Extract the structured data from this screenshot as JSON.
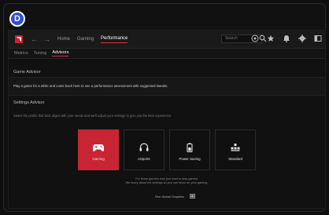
{
  "badge": "D",
  "topbar": {
    "nav": [
      "Home",
      "Gaming",
      "Performance"
    ],
    "active_nav": "Performance",
    "search_placeholder": "Search"
  },
  "subtabs": [
    "Metrics",
    "Tuning",
    "Advisors"
  ],
  "game_advisor": {
    "title": "Game Advisor",
    "message": "Play a game for a while and come back here to see a performance assessment with suggested tweaks."
  },
  "settings_advisor": {
    "title": "Settings Advisor",
    "description": "Select the profile that best aligns with your needs and we'll adjust your settings to give you the best experience.",
    "profiles": [
      {
        "label": "Gaming",
        "icon": "gamepad-icon",
        "selected": true
      },
      {
        "label": "eSports",
        "icon": "headset-icon",
        "selected": false
      },
      {
        "label": "Power Saving",
        "icon": "battery-icon",
        "selected": false
      },
      {
        "label": "Standard",
        "icon": "standard-icon",
        "selected": false
      }
    ],
    "note_line1": "For those gamers who just want to play games.",
    "note_line2": "We worry about the settings so you can focus on your gaming.",
    "global_graphics": "See Global Graphics"
  },
  "colors": {
    "accent": "#d12f3c",
    "selected_card": "#c92433",
    "badge": "#2f4be0"
  }
}
